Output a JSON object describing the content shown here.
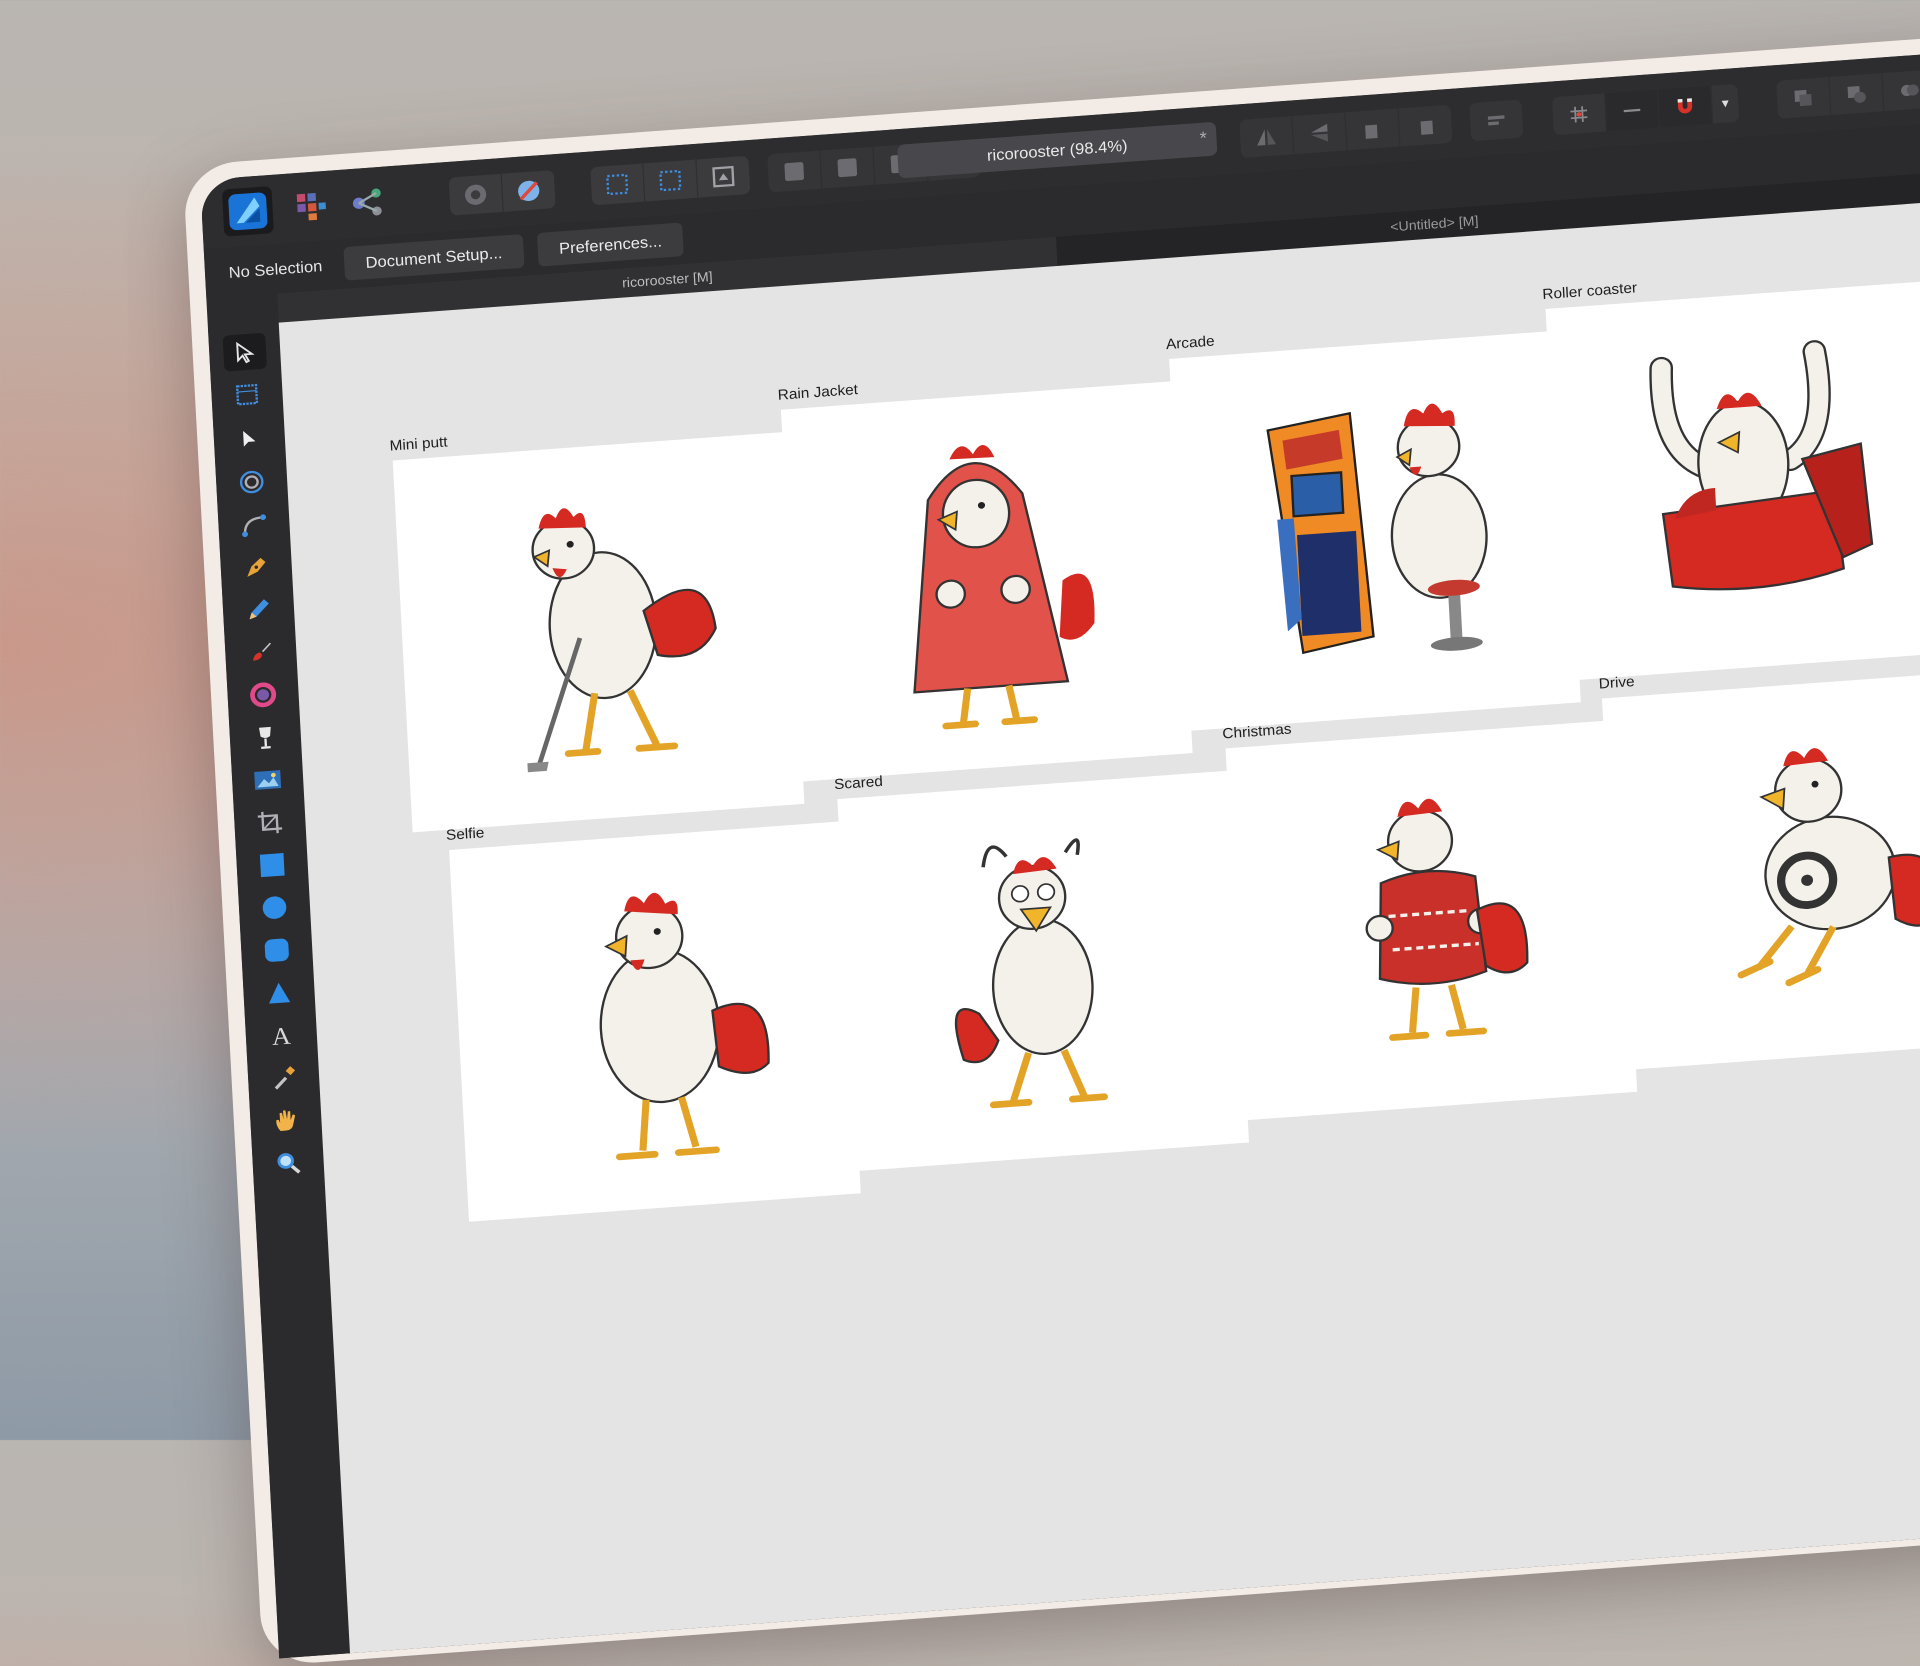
{
  "toolbar": {
    "document_title": "ricorooster (98.4%)",
    "close_glyph": "*"
  },
  "context_bar": {
    "selection_status": "No Selection",
    "document_setup_label": "Document Setup...",
    "preferences_label": "Preferences..."
  },
  "tabs": {
    "active": "ricorooster [M]",
    "other": "<Untitled> [M]"
  },
  "artboards": [
    {
      "label": "Mini putt",
      "depicts": "rooster golfing with a putter"
    },
    {
      "label": "Rain Jacket",
      "depicts": "rooster in red rain poncho giving thumbs up"
    },
    {
      "label": "Arcade",
      "depicts": "rooster playing arcade cabinet"
    },
    {
      "label": "Roller coaster",
      "depicts": "rooster screaming in red roller coaster car"
    },
    {
      "label": "Selfie",
      "depicts": "rooster standing with hands on hips"
    },
    {
      "label": "Scared",
      "depicts": "rooster scared with hands on head"
    },
    {
      "label": "Christmas",
      "depicts": "rooster in christmas sweater thumbs up"
    },
    {
      "label": "Drive",
      "depicts": "rooster holding steering wheel"
    }
  ],
  "colors": {
    "accent_blue": "#2f8fe8",
    "rooster_red": "#d42a22",
    "beak_yellow": "#f1b52c",
    "feather_white": "#f4f1ea"
  },
  "icons": {
    "tools": [
      "move-tool-icon",
      "artboard-tool-icon",
      "node-tool-icon",
      "contour-tool-icon",
      "corner-tool-icon",
      "pen-tool-icon",
      "pencil-tool-icon",
      "brush-tool-icon",
      "color-picker-icon",
      "transparency-tool-icon",
      "place-image-icon",
      "crop-tool-icon",
      "rectangle-tool-icon",
      "ellipse-tool-icon",
      "rounded-rectangle-tool-icon",
      "triangle-tool-icon",
      "text-tool-icon",
      "eyedropper-icon",
      "hand-tool-icon",
      "zoom-tool-icon"
    ]
  }
}
